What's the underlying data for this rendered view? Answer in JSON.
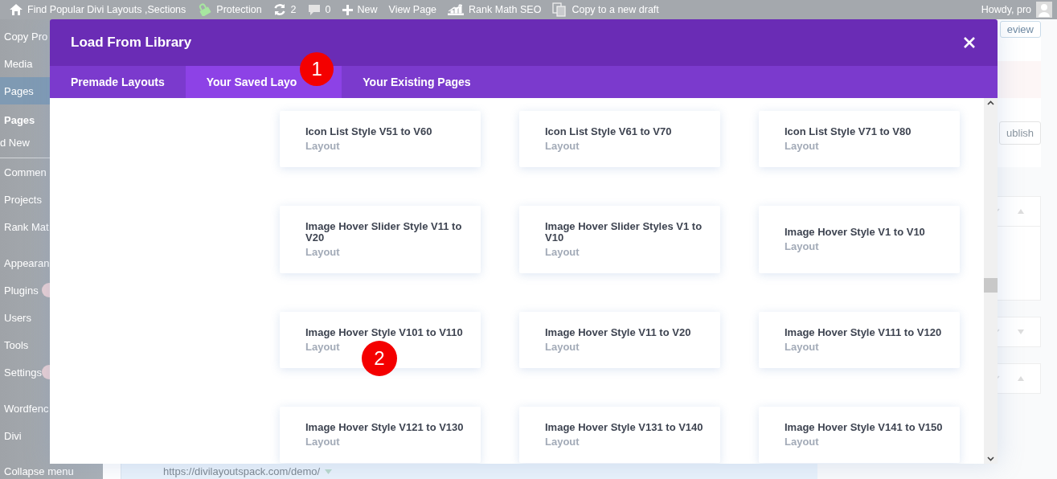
{
  "admin_bar": {
    "items": [
      {
        "kind": "home",
        "label": "Find Popular Divi Layouts ,Sections"
      },
      {
        "kind": "shield",
        "label": "Protection"
      },
      {
        "kind": "refresh",
        "label": "2"
      },
      {
        "kind": "comment",
        "label": "0"
      },
      {
        "kind": "plus",
        "label": "New"
      },
      {
        "kind": "text",
        "label": "View Page"
      },
      {
        "kind": "chart",
        "label": "Rank Math SEO"
      },
      {
        "kind": "copy",
        "label": "Copy to a new draft"
      }
    ],
    "greeting": "Howdy, pro"
  },
  "sidebar": {
    "items": [
      {
        "label": "Copy Pro",
        "kind": "item",
        "selected": false,
        "badge": false
      },
      {
        "label": "Media",
        "kind": "item",
        "selected": false,
        "badge": false
      },
      {
        "label": "Pages",
        "kind": "item",
        "selected": true,
        "badge": false
      },
      {
        "label": "Pages",
        "kind": "heading",
        "selected": false,
        "badge": false
      },
      {
        "label": "d New",
        "kind": "sub",
        "selected": false,
        "badge": false
      },
      {
        "label": "Commen",
        "kind": "item",
        "selected": false,
        "badge": false
      },
      {
        "label": "Projects",
        "kind": "item",
        "selected": false,
        "badge": false
      },
      {
        "label": "Rank Mat",
        "kind": "item",
        "selected": false,
        "badge": false
      },
      {
        "label": "Appearan",
        "kind": "item",
        "selected": false,
        "badge": false
      },
      {
        "label": "Plugins",
        "kind": "item",
        "selected": false,
        "badge": true
      },
      {
        "label": "Users",
        "kind": "item",
        "selected": false,
        "badge": false
      },
      {
        "label": "Tools",
        "kind": "item",
        "selected": false,
        "badge": false
      },
      {
        "label": "Settings",
        "kind": "item",
        "selected": false,
        "badge": true
      },
      {
        "label": "Wordfenc",
        "kind": "item",
        "selected": false,
        "badge": false
      },
      {
        "label": "Divi",
        "kind": "item",
        "selected": false,
        "badge": false
      }
    ],
    "collapse": "Collapse menu"
  },
  "right_panel": {
    "preview_button": "eview",
    "publish_button": "ublish"
  },
  "url_bar": {
    "url": "https://divilayoutspack.com/demo/"
  },
  "modal": {
    "title": "Load From Library",
    "tabs": [
      {
        "label": "Premade Layouts",
        "selected": false
      },
      {
        "label": "Your Saved Layo",
        "selected": true,
        "marker": "1"
      },
      {
        "label": "Your Existing Pages",
        "selected": false
      }
    ],
    "layouts": [
      {
        "title": "Icon List Style V51 to V60",
        "type": "Layout"
      },
      {
        "title": "Icon List Style V61 to V70",
        "type": "Layout"
      },
      {
        "title": "Icon List Style V71 to V80",
        "type": "Layout"
      },
      {
        "title": "Image Hover Slider Style V11 to V20",
        "type": "Layout"
      },
      {
        "title": "Image Hover Slider Styles V1 to V10",
        "type": "Layout"
      },
      {
        "title": "Image Hover Style V1 to V10",
        "type": "Layout"
      },
      {
        "title": "Image Hover Style V101 to V110",
        "type": "Layout",
        "marker": "2"
      },
      {
        "title": "Image Hover Style V11 to V20",
        "type": "Layout"
      },
      {
        "title": "Image Hover Style V111 to V120",
        "type": "Layout"
      },
      {
        "title": "Image Hover Style V121 to V130",
        "type": "Layout"
      },
      {
        "title": "Image Hover Style V131 to V140",
        "type": "Layout"
      },
      {
        "title": "Image Hover Style V141 to V150",
        "type": "Layout"
      }
    ]
  }
}
